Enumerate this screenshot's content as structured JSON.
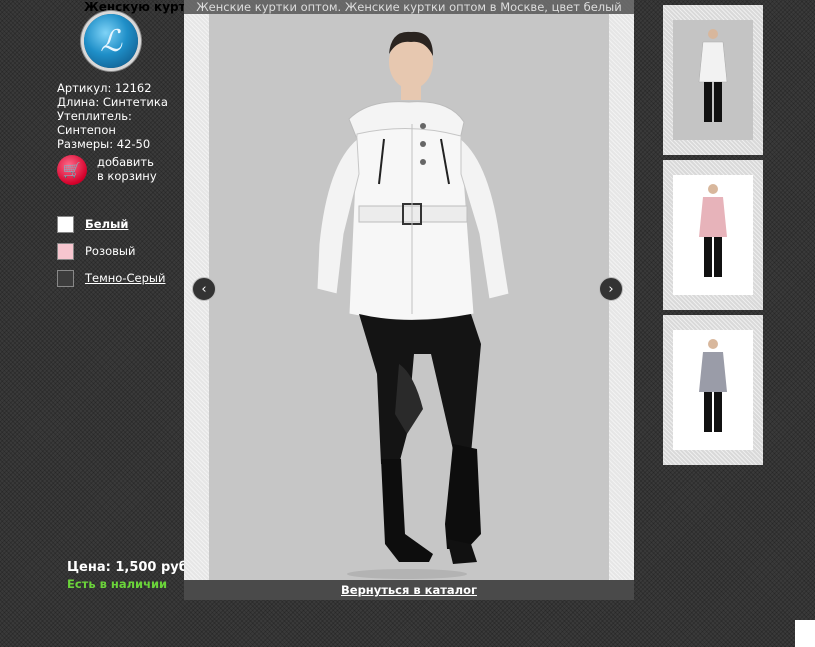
{
  "page": {
    "heading": "Женскую курткu"
  },
  "specs": {
    "article": "Артикул: 12162",
    "length": "Длина: Синтетика",
    "insulation_label": "Утеплитель:",
    "insulation_value": "Синтепон",
    "sizes": "Размеры: 42-50"
  },
  "cart": {
    "line1": "добавить",
    "line2": "в корзину"
  },
  "colors": [
    {
      "label": "Белый",
      "hex": "#ffffff"
    },
    {
      "label": "Розовый",
      "hex": "#f7c6cf"
    },
    {
      "label": "Темно-Серый",
      "hex": "#3c3c3c"
    }
  ],
  "price": "Цена: 1,500 руб.",
  "stock": "Есть в наличии",
  "lightbox": {
    "title": "Женские куртки оптом. Женские куртки оптом в Москве, цвет белый",
    "back_link": "Вернуться в каталог",
    "prev_glyph": "‹",
    "next_glyph": "›"
  },
  "thumbnails": [
    {
      "jacket": "#f2f2f2"
    },
    {
      "jacket": "#e7b3ba"
    },
    {
      "jacket": "#9a9ca8"
    }
  ],
  "theme": {
    "accent_green": "#6bd43a",
    "cart_red": "#d4002a"
  }
}
